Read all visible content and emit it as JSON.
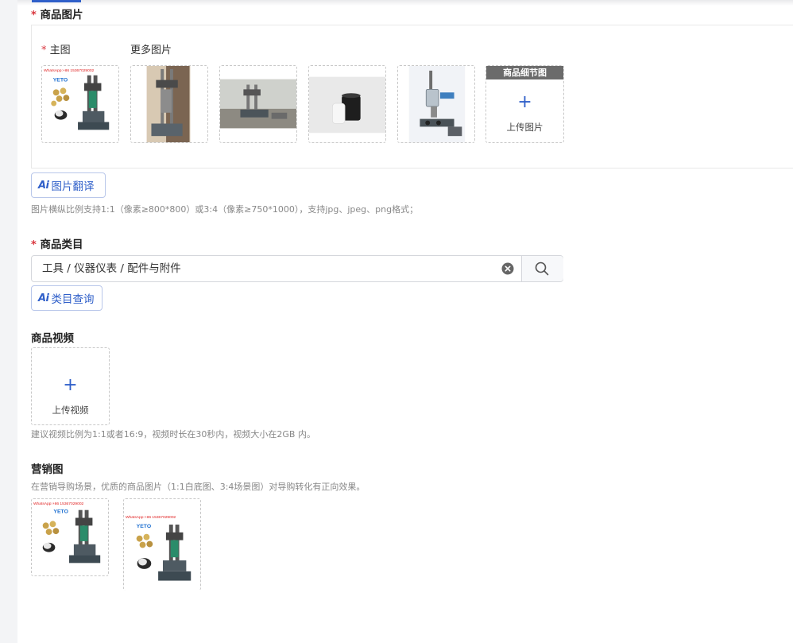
{
  "product_images": {
    "title": "商品图片",
    "main_label": "主图",
    "more_label": "更多图片",
    "images": [
      {
        "kind": "main-collage",
        "watermark": "WhatsApp:+86 15367029002",
        "brand": "YETO"
      },
      {
        "kind": "machine-photo"
      },
      {
        "kind": "workbench-photo"
      },
      {
        "kind": "cylinder-photo"
      },
      {
        "kind": "pneumatic-press-photo"
      }
    ],
    "detail_badge": "商品细节图",
    "upload_label": "上传图片",
    "ai_translate_label": "图片翻译",
    "hint": "图片横纵比例支持1:1（像素≥800*800）或3:4（像素≥750*1000），支持jpg、jpeg、png格式；"
  },
  "category": {
    "title": "商品类目",
    "value": "工具 / 仪器仪表 / 配件与附件",
    "ai_query_label": "类目查询"
  },
  "video": {
    "title": "商品视频",
    "upload_label": "上传视频",
    "hint": "建议视频比例为1:1或者16:9，视频时长在30秒内，视频大小在2GB 内。"
  },
  "marketing": {
    "title": "营销图",
    "hint": "在营销导购场景，优质的商品图片（1:1白底图、3:4场景图）对导购转化有正向效果。",
    "images": [
      {
        "kind": "square-collage",
        "watermark": "WhatsApp:+86 15367029002",
        "brand": "YETO"
      },
      {
        "kind": "portrait-collage",
        "watermark": "WhatsApp:+86 15367029002",
        "brand": "YETO"
      }
    ]
  },
  "ai_mark": "Ai",
  "colors": {
    "accent": "#2f5fc9",
    "required": "#d9363e",
    "hint": "#888888"
  }
}
